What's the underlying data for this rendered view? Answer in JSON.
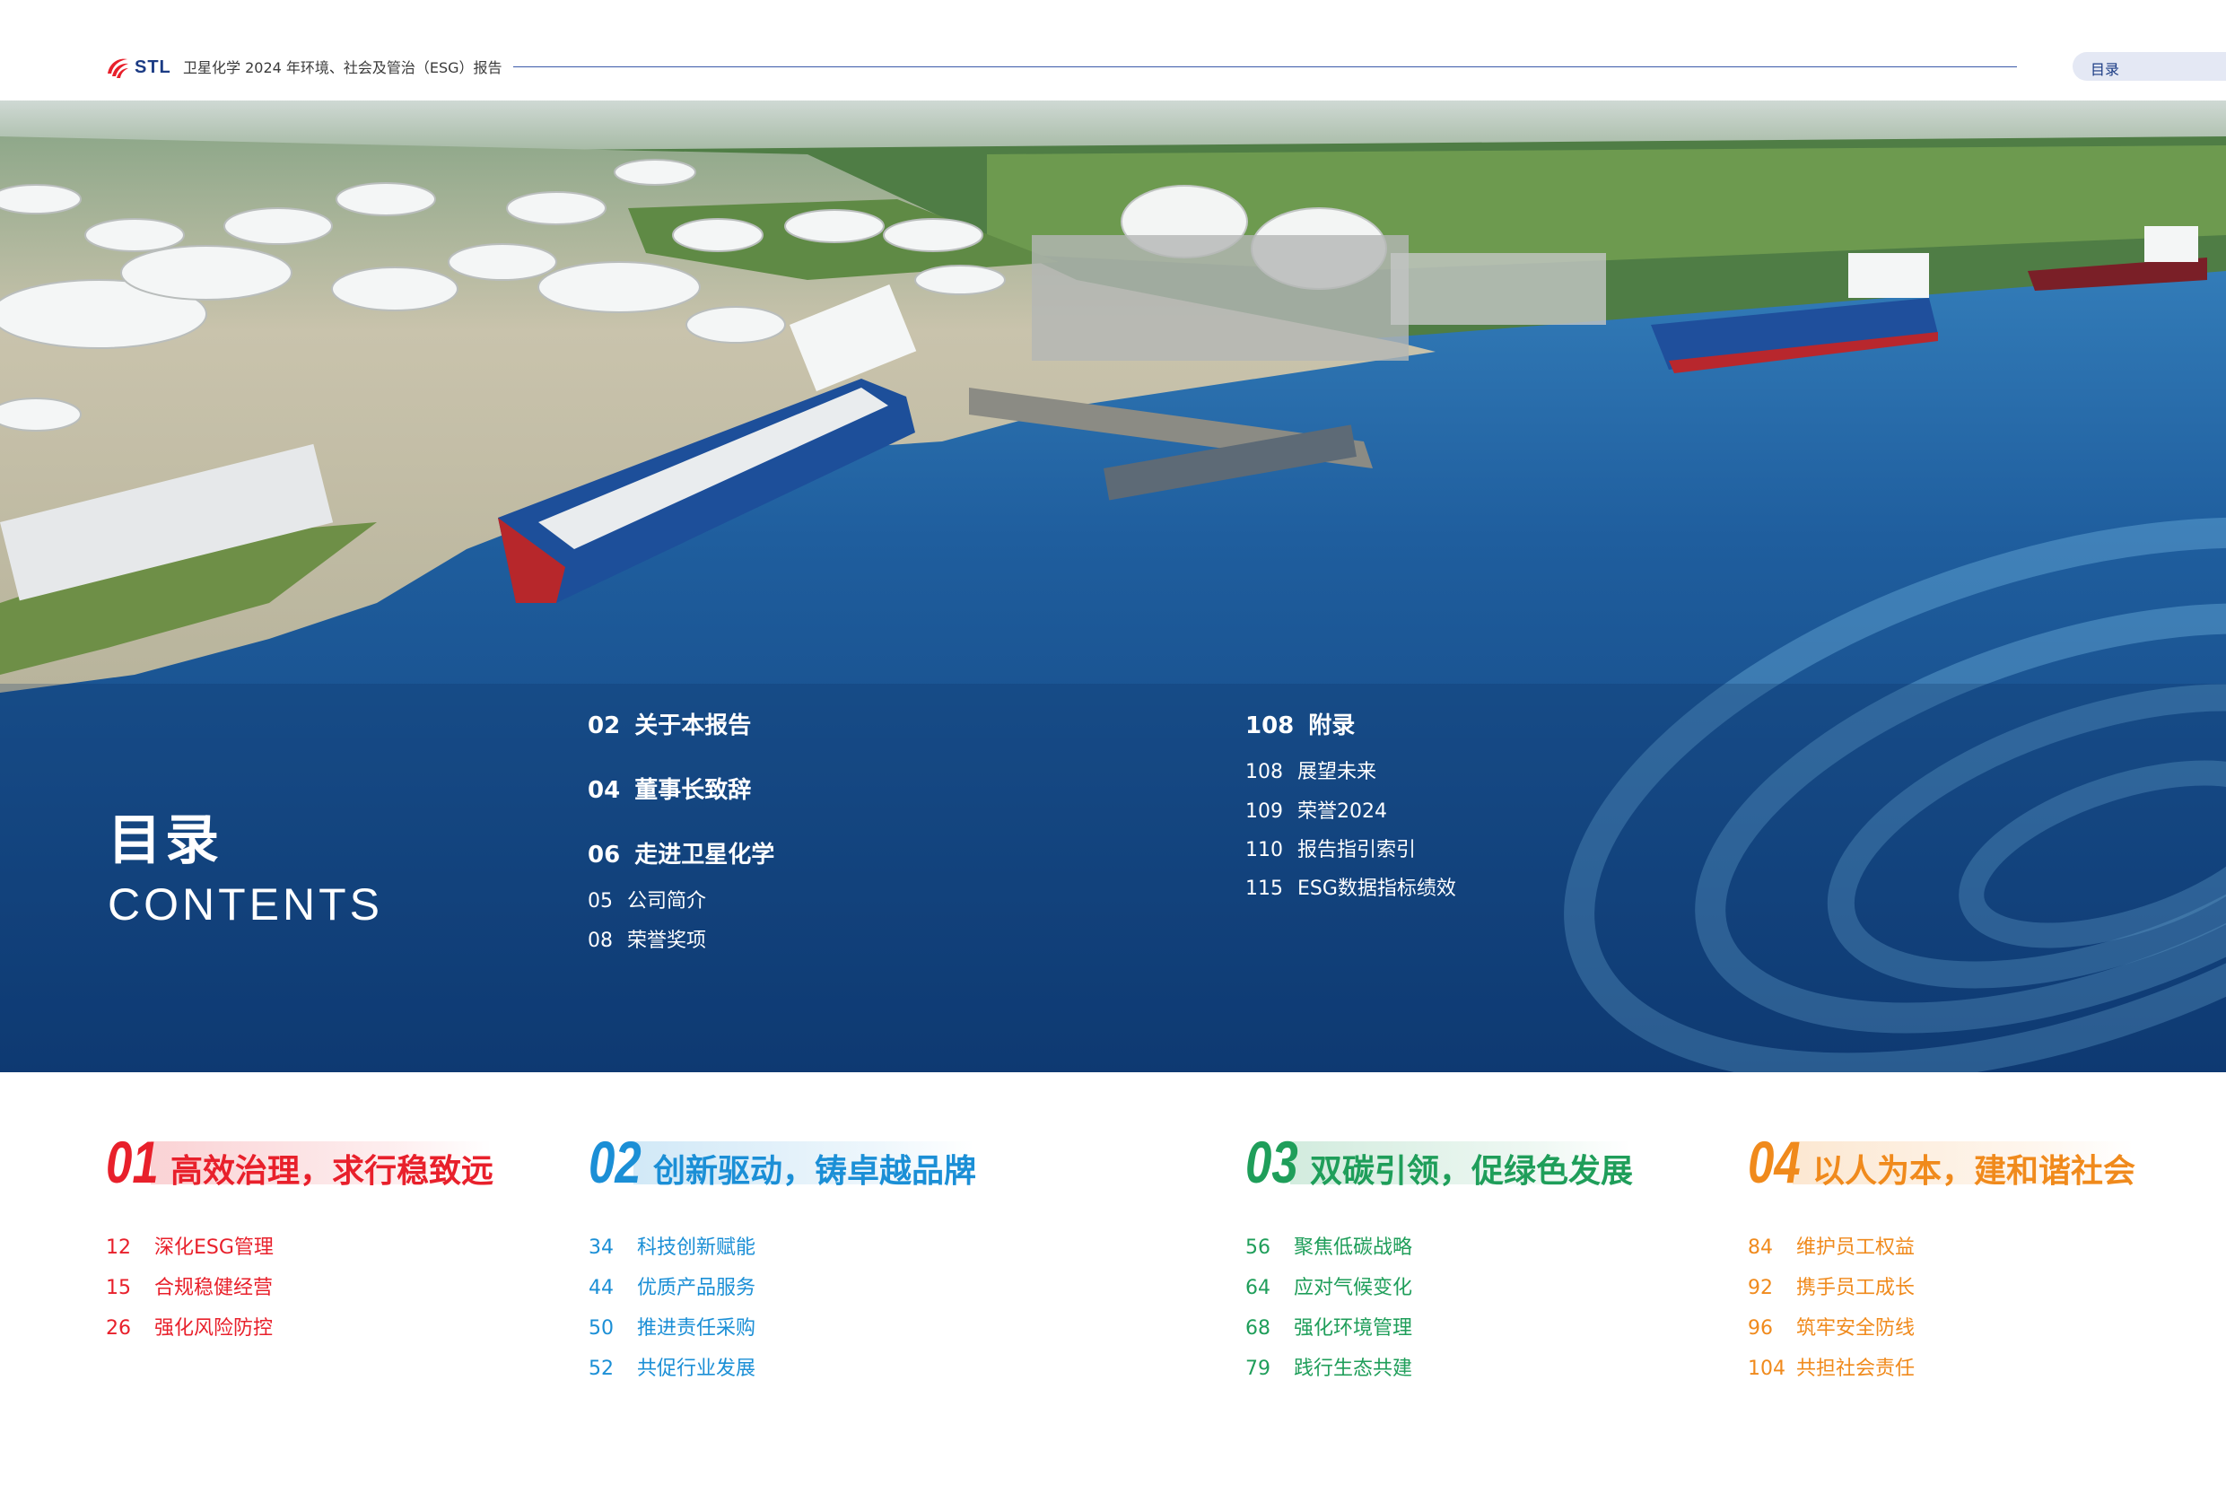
{
  "header": {
    "logo_text": "STL",
    "report_title": "卫星化学 2024 年环境、社会及管治（ESG）报告",
    "tab_label": "目录"
  },
  "contents": {
    "title_zh": "目录",
    "title_en": "CONTENTS"
  },
  "toc_col1": [
    {
      "num": "02",
      "label": "关于本报告",
      "level": "major"
    },
    {
      "num": "04",
      "label": "董事长致辞",
      "level": "major"
    },
    {
      "num": "06",
      "label": "走进卫星化学",
      "level": "major"
    },
    {
      "num": "05",
      "label": "公司简介",
      "level": "minor"
    },
    {
      "num": "08",
      "label": "荣誉奖项",
      "level": "minor"
    }
  ],
  "toc_col2": [
    {
      "num": "108",
      "label": "附录",
      "level": "major"
    },
    {
      "num": "108",
      "label": "展望未来",
      "level": "minor"
    },
    {
      "num": "109",
      "label": "荣誉2024",
      "level": "minor"
    },
    {
      "num": "110",
      "label": "报告指引索引",
      "level": "minor"
    },
    {
      "num": "115",
      "label": "ESG数据指标绩效",
      "level": "minor"
    }
  ],
  "chapters": [
    {
      "num": "01",
      "title": "高效治理，求行稳致远",
      "color": "#e8202b",
      "items": [
        {
          "num": "12",
          "label": "深化ESG管理"
        },
        {
          "num": "15",
          "label": "合规稳健经营"
        },
        {
          "num": "26",
          "label": "强化风险防控"
        }
      ]
    },
    {
      "num": "02",
      "title": "创新驱动，铸卓越品牌",
      "color": "#1b8fd6",
      "items": [
        {
          "num": "34",
          "label": "科技创新赋能"
        },
        {
          "num": "44",
          "label": "优质产品服务"
        },
        {
          "num": "50",
          "label": "推进责任采购"
        },
        {
          "num": "52",
          "label": "共促行业发展"
        }
      ]
    },
    {
      "num": "03",
      "title": "双碳引领，促绿色发展",
      "color": "#1f9e5a",
      "items": [
        {
          "num": "56",
          "label": "聚焦低碳战略"
        },
        {
          "num": "64",
          "label": "应对气候变化"
        },
        {
          "num": "68",
          "label": "强化环境管理"
        },
        {
          "num": "79",
          "label": "践行生态共建"
        }
      ]
    },
    {
      "num": "04",
      "title": "以人为本，建和谐社会",
      "color": "#f08a1c",
      "items": [
        {
          "num": "84",
          "label": "维护员工权益"
        },
        {
          "num": "92",
          "label": "携手员工成长"
        },
        {
          "num": "96",
          "label": "筑牢安全防线"
        },
        {
          "num": "104",
          "label": "共担社会责任"
        }
      ]
    }
  ]
}
